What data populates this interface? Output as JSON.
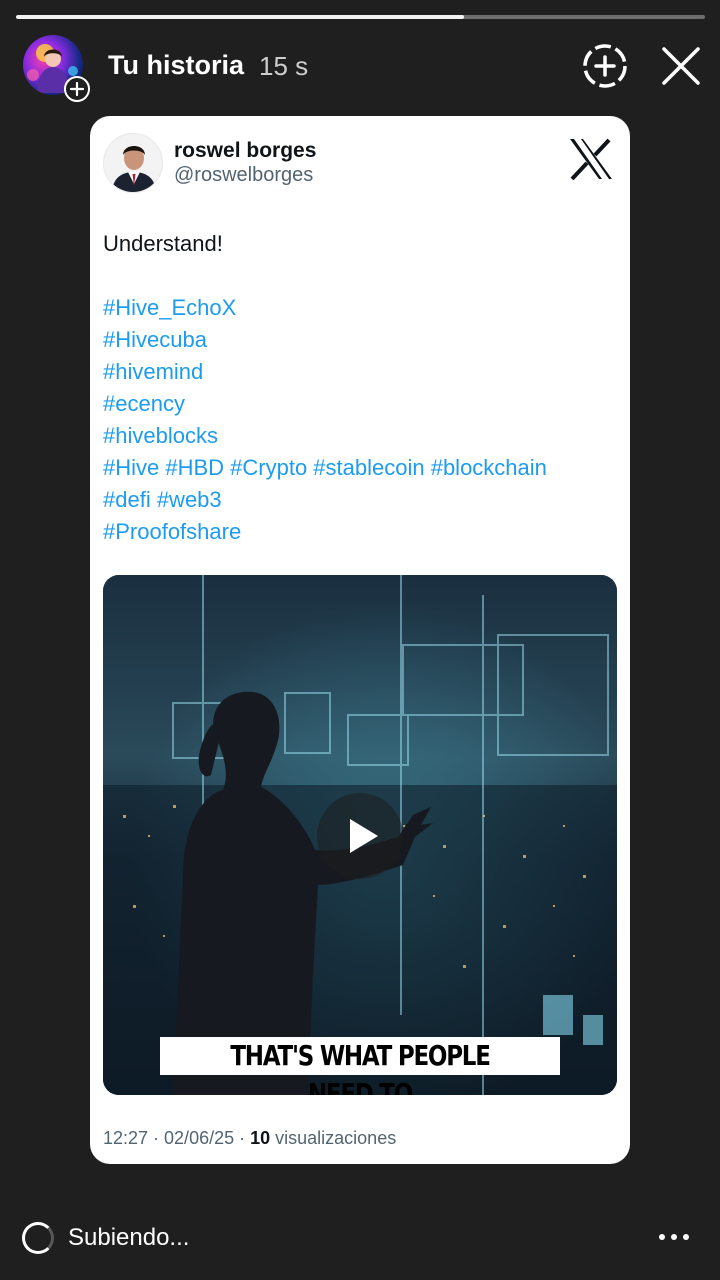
{
  "story": {
    "title": "Tu historia",
    "time": "15 s",
    "progress": 0.65
  },
  "icons": {
    "avatar": "user-avatar",
    "add": "add-circle-icon",
    "close": "close-icon",
    "brand": "x-logo-icon",
    "play": "play-icon",
    "more": "more-horizontal-icon",
    "spinner": "loading-spinner-icon"
  },
  "tweet": {
    "author_name": "roswel borges",
    "author_handle": "@roswelborges",
    "text": "Understand!",
    "hashtag_lines": [
      "#Hive_EchoX",
      "#Hivecuba",
      "#hivemind",
      "#ecency",
      "#hiveblocks",
      "#Hive #HBD #Crypto #stablecoin #blockchain",
      "#defi #web3",
      "#Proofofshare"
    ],
    "video_caption": "THAT'S WHAT PEOPLE NEED TO",
    "timestamp": "12:27 · 02/06/25 · ",
    "views_count": "10",
    "views_label": " visualizaciones"
  },
  "footer": {
    "status": "Subiendo..."
  },
  "colors": {
    "background": "#1f1f1f",
    "link": "#1d9bf0",
    "card": "#ffffff"
  }
}
